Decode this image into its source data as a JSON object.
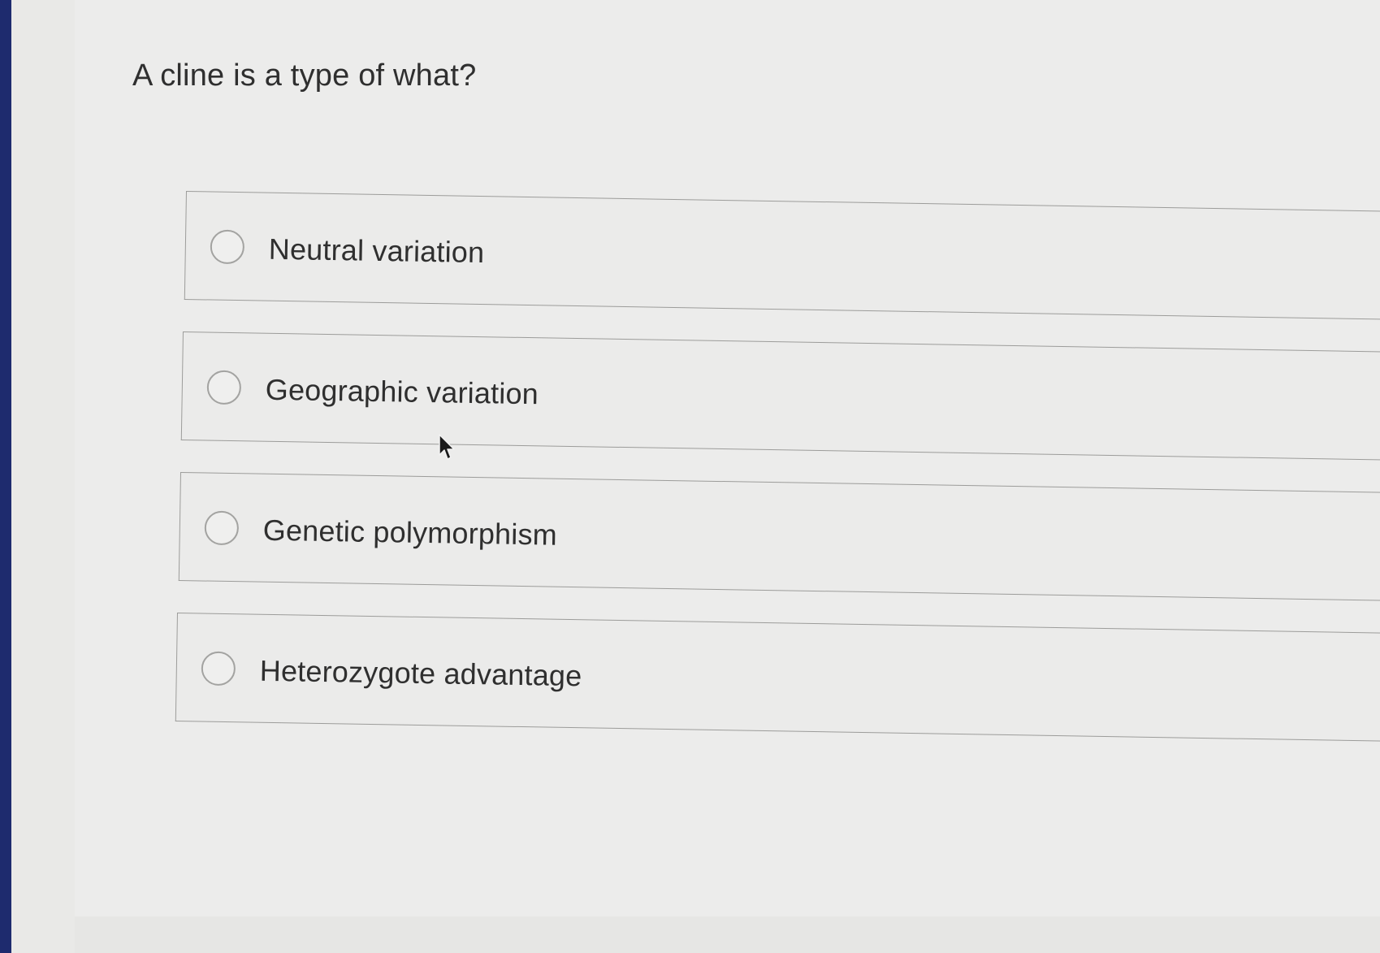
{
  "question": {
    "text": "A cline is a type of what?"
  },
  "options": [
    {
      "label": "Neutral variation",
      "selected": false
    },
    {
      "label": "Geographic variation",
      "selected": false
    },
    {
      "label": "Genetic polymorphism",
      "selected": false
    },
    {
      "label": "Heterozygote advantage",
      "selected": false
    }
  ],
  "icons": {
    "cursor": "mouse-pointer-icon",
    "radio": "radio-unchecked-icon"
  }
}
